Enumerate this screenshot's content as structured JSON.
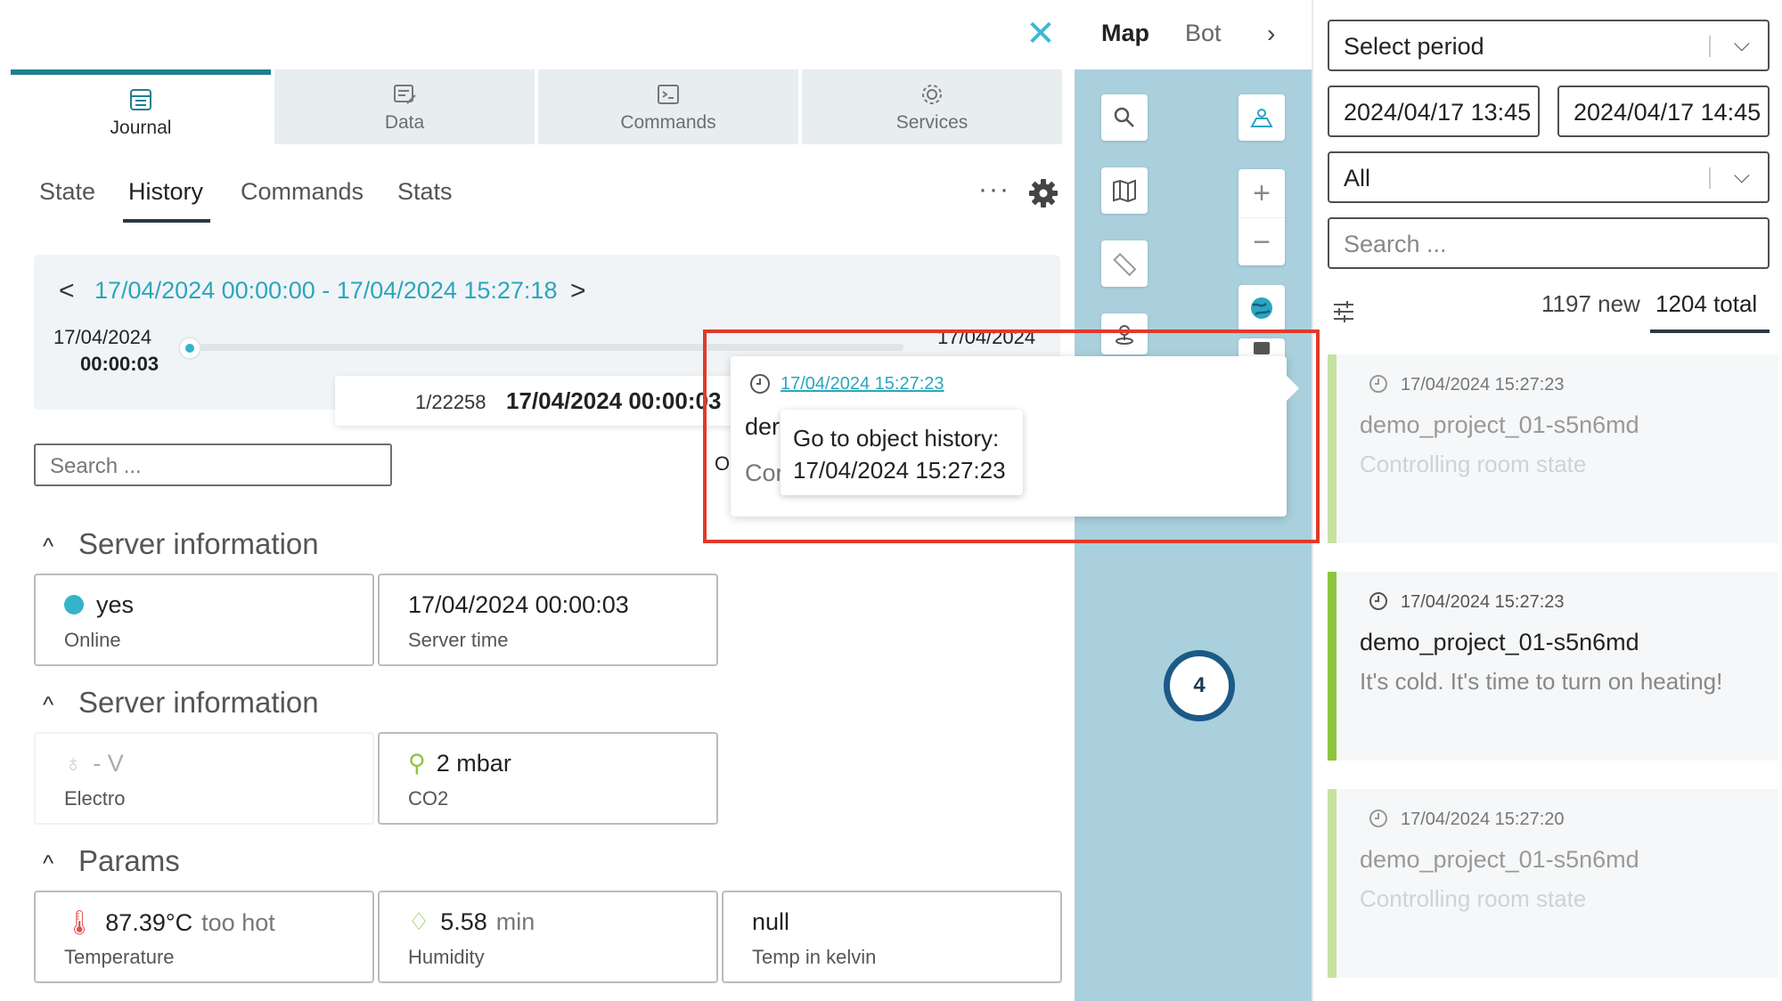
{
  "left": {
    "main_tabs": [
      {
        "label": "Journal"
      },
      {
        "label": "Data"
      },
      {
        "label": "Commands"
      },
      {
        "label": "Services"
      }
    ],
    "sub_tabs": [
      {
        "label": "State"
      },
      {
        "label": "History"
      },
      {
        "label": "Commands"
      },
      {
        "label": "Stats"
      }
    ],
    "more_label": "···",
    "range": {
      "label": "17/04/2024 00:00:00 - 17/04/2024 15:27:18",
      "start_date": "17/04/2024",
      "start_time": "00:00:03",
      "end_date": "17/04/2024",
      "position_count": "1/22258",
      "position_date": "17/04/2024 00:00:03"
    },
    "search_placeholder": "Search ...",
    "sections": [
      {
        "title": "Server information"
      },
      {
        "title": "Server information"
      },
      {
        "title": "Params"
      }
    ],
    "cards": {
      "online": {
        "value": "yes",
        "label": "Online"
      },
      "server_time": {
        "value": "17/04/2024 00:00:03",
        "label": "Server time"
      },
      "electro": {
        "value": "- V",
        "label": "Electro"
      },
      "co2": {
        "value": "2 mbar",
        "label": "CO2"
      },
      "temperature": {
        "value": "87.39°C",
        "note": "too hot",
        "label": "Temperature"
      },
      "humidity": {
        "value": "5.58",
        "note": "min",
        "label": "Humidity"
      },
      "kelvin": {
        "value": "null",
        "label": "Temp in kelvin"
      }
    }
  },
  "map": {
    "tabs": [
      {
        "label": "Map"
      },
      {
        "label": "Bot"
      }
    ],
    "cluster_count": "4"
  },
  "right": {
    "period_select": "Select period",
    "date_from": "2024/04/17 13:45",
    "date_to": "2024/04/17 14:45",
    "type_select": "All",
    "search_placeholder": "Search ...",
    "count_new": "1197 new",
    "count_total": "1204 total",
    "events": [
      {
        "time": "17/04/2024 15:27:23",
        "name": "demo_project_01-s5n6md",
        "message": "Controlling room state"
      },
      {
        "time": "17/04/2024 15:27:23",
        "name": "demo_project_01-s5n6md",
        "message": "It's cold. It's time to turn on heating!"
      },
      {
        "time": "17/04/2024 15:27:20",
        "name": "demo_project_01-s5n6md",
        "message": "Controlling room state"
      }
    ]
  },
  "popup": {
    "link": "17/04/2024 15:27:23",
    "frag1": "der",
    "frag2": "Cor",
    "frag3": "O",
    "tooltip_line1": "Go to object history:",
    "tooltip_line2": "17/04/2024 15:27:23"
  },
  "colors": {
    "accent": "#2aa6bd",
    "tab_active_border": "#1e7f91",
    "map_bg": "#a9d0dc",
    "event_border_strong": "#8cc63f",
    "event_border_faint": "#c5e3a0",
    "highlight": "#e03a2a"
  }
}
